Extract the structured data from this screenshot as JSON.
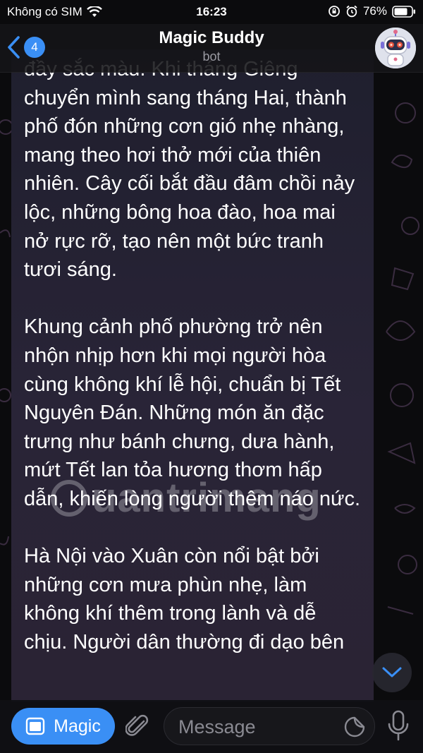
{
  "status_bar": {
    "carrier": "Không có SIM",
    "time": "16:23",
    "battery": "76%",
    "icons": [
      "wifi-icon",
      "orientation-lock-icon",
      "alarm-icon",
      "battery-icon"
    ]
  },
  "header": {
    "back_count": "4",
    "title": "Magic Buddy",
    "subtitle": "bot",
    "icons": [
      "chevron-left-icon",
      "robot-avatar"
    ]
  },
  "message": {
    "text": "đầy sắc màu. Khi tháng Giêng chuyển mình sang tháng Hai, thành phố đón những cơn gió nhẹ nhàng, mang theo hơi thở mới của thiên nhiên. Cây cối bắt đầu đâm chồi nảy lộc, những bông hoa đào, hoa mai nở rực rỡ, tạo nên một bức tranh tươi sáng.\n\nKhung cảnh phố phường trở nên nhộn nhịp hơn khi mọi người hòa cùng không khí lễ hội, chuẩn bị Tết Nguyên Đán. Những món ăn đặc trưng như bánh chưng, dưa hành, mứt Tết lan tỏa hương thơm hấp dẫn, khiến lòng người thêm náo nức.\n\nHà Nội vào Xuân còn nổi bật bởi những cơn mưa phùn nhẹ, làm không khí thêm trong lành và dễ chịu. Người dân thường đi dạo bên"
  },
  "watermark": "uantrimang",
  "input_bar": {
    "menu_label": "Magic",
    "placeholder": "Message",
    "icons": [
      "menu-app-icon",
      "paperclip-icon",
      "sticker-icon",
      "microphone-icon",
      "chevron-down-icon"
    ]
  },
  "colors": {
    "accent": "#3a8ff5",
    "background": "#0b0b0d",
    "bubble": "#262232"
  }
}
